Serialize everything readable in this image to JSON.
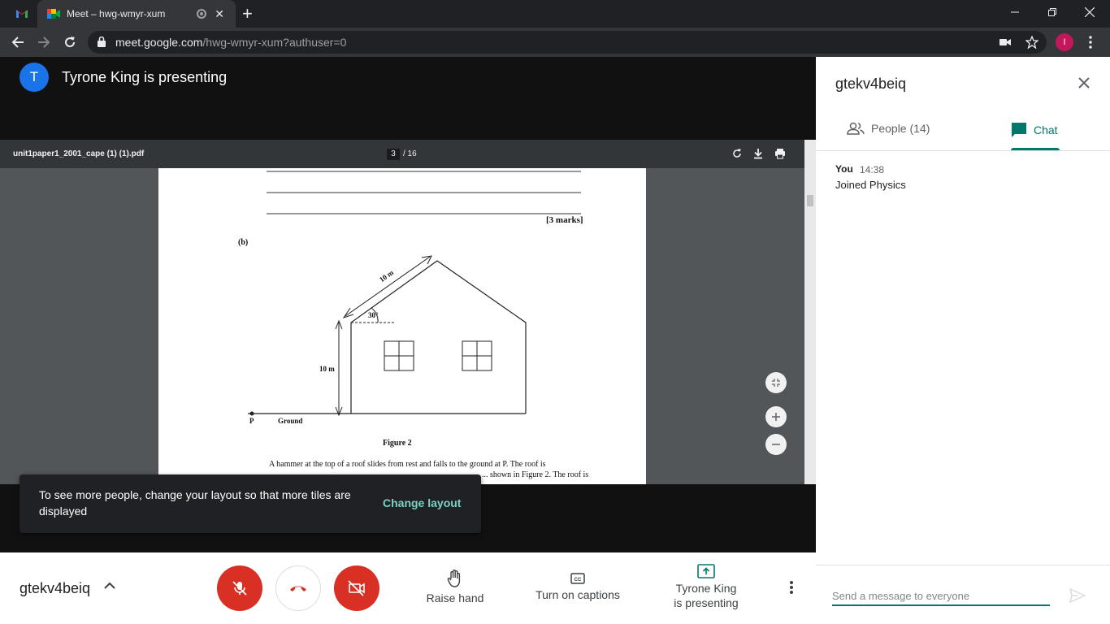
{
  "browser": {
    "inactive_tab_icon": "gmail-icon",
    "active_tab": {
      "title": "Meet – hwg-wmyr-xum",
      "icon": "meet-icon"
    },
    "url_host": "meet.google.com",
    "url_path": "/hwg-wmyr-xum?authuser=0",
    "profile_initial": "I",
    "profile_color": "#c2185b"
  },
  "presenter": {
    "initial": "T",
    "title": "Tyrone King is presenting",
    "avatar_color": "#1a73e8"
  },
  "pdf": {
    "filename": "unit1paper1_2001_cape (1) (1).pdf",
    "current_page": "3",
    "total_pages": "/ 16",
    "marks": "[3 marks]",
    "part_label": "(b)",
    "angle_label": "30°",
    "roof_label": "10 m",
    "height_label": "10 m",
    "point_label": "P",
    "ground_label": "Ground",
    "figure_caption": "Figure 2",
    "body_line1": "A hammer at the top of a roof slides from rest and falls to the ground at P. The roof is",
    "body_line2": "... shown in Figure 2. The roof is"
  },
  "snackbar": {
    "text": "To see more people, change your layout so that more tiles are displayed",
    "action": "Change layout"
  },
  "bottombar": {
    "meeting_code": "gtekv4beiq",
    "raise_hand": "Raise hand",
    "captions": "Turn on captions",
    "presenting_line1": "Tyrone King",
    "presenting_line2": "is presenting"
  },
  "panel": {
    "title": "gtekv4beiq",
    "people_tab": "People (14)",
    "chat_tab": "Chat",
    "messages": [
      {
        "sender": "You",
        "time": "14:38",
        "text": "Joined Physics"
      }
    ],
    "composer_placeholder": "Send a message to everyone"
  },
  "colors": {
    "accent": "#00796b",
    "danger": "#d93025",
    "snack_action": "#7fcfc4"
  }
}
